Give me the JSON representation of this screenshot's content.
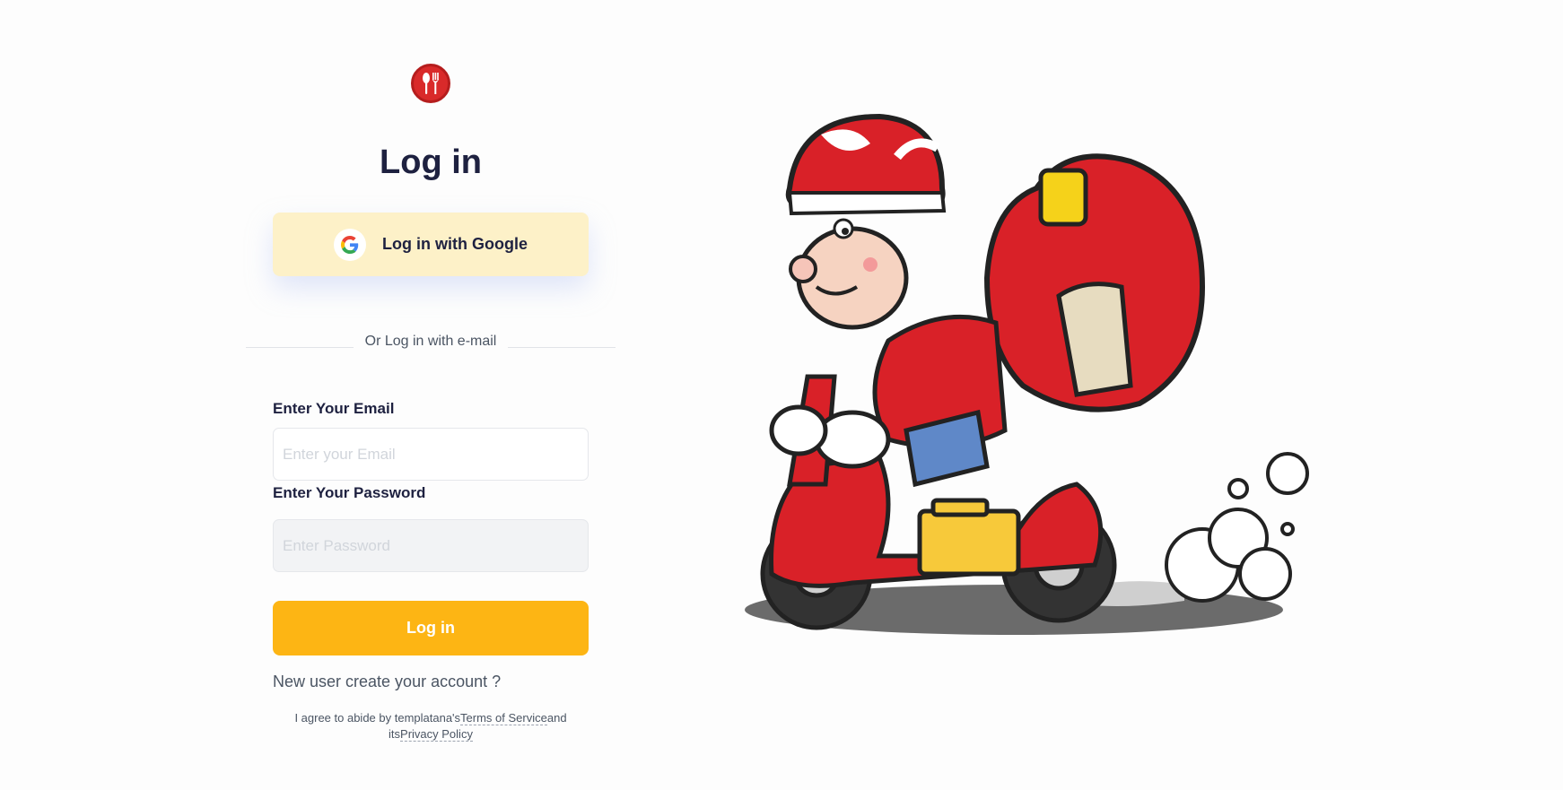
{
  "title": "Log in",
  "google_button": {
    "label": "Log in with Google",
    "icon": "google-icon"
  },
  "divider_text": "Or Log in with e-mail",
  "email": {
    "label": "Enter Your Email",
    "placeholder": "Enter your Email",
    "value": ""
  },
  "password": {
    "label": "Enter Your Password",
    "placeholder": "Enter Password",
    "value": ""
  },
  "submit_label": "Log in",
  "signup_text": "New user create your account ?",
  "terms": {
    "prefix": "I agree to abide by templatana's",
    "tos_link": "Terms of Service",
    "middle": "and its",
    "privacy_link": "Privacy Policy"
  },
  "colors": {
    "primary": "#fdb514",
    "google_bg": "#fdf1c8",
    "logo_red": "#d92a2a",
    "heading": "#1e2140"
  },
  "logo_icon": "spoon-fork-icon",
  "illustration": "delivery-scooter-illustration"
}
